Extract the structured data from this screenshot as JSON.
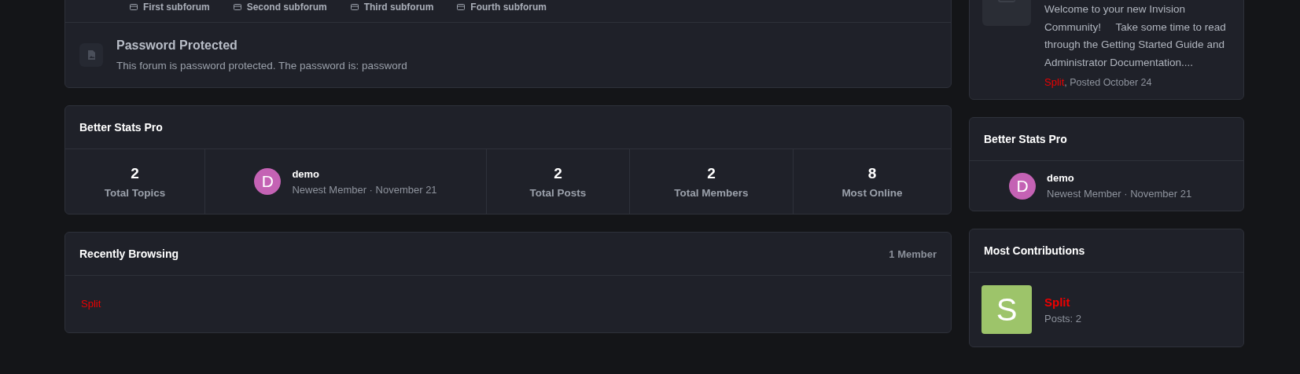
{
  "forum_card": {
    "subforums": [
      "First subforum",
      "Second subforum",
      "Third subforum",
      "Fourth subforum"
    ],
    "forum": {
      "title": "Password Protected",
      "description": "This forum is password protected. The password is: password"
    }
  },
  "stats_card": {
    "title": "Better Stats Pro",
    "stats": [
      {
        "kind": "stat",
        "value": "2",
        "label": "Total Topics"
      },
      {
        "kind": "member",
        "initial": "D",
        "name": "demo",
        "detail": "Newest Member · November 21"
      },
      {
        "kind": "stat",
        "value": "2",
        "label": "Total Posts"
      },
      {
        "kind": "stat",
        "value": "2",
        "label": "Total Members"
      },
      {
        "kind": "stat",
        "value": "8",
        "label": "Most Online"
      }
    ]
  },
  "recently_browsing": {
    "title": "Recently Browsing",
    "count": "1 Member",
    "members": [
      "Split"
    ]
  },
  "sidebar": {
    "latest_post": {
      "excerpt": "Welcome to your new Invision Community!     Take some time to read through the Getting Started Guide and Administrator Documentation....",
      "author": "Split",
      "posted": ", Posted October 24"
    },
    "stats": {
      "title": "Better Stats Pro",
      "newest_member": {
        "initial": "D",
        "name": "demo",
        "detail": "Newest Member · November 21"
      }
    },
    "most_contributions": {
      "title": "Most Contributions",
      "members": [
        {
          "initial": "S",
          "name": "Split",
          "posts": "Posts: 2"
        }
      ]
    }
  }
}
